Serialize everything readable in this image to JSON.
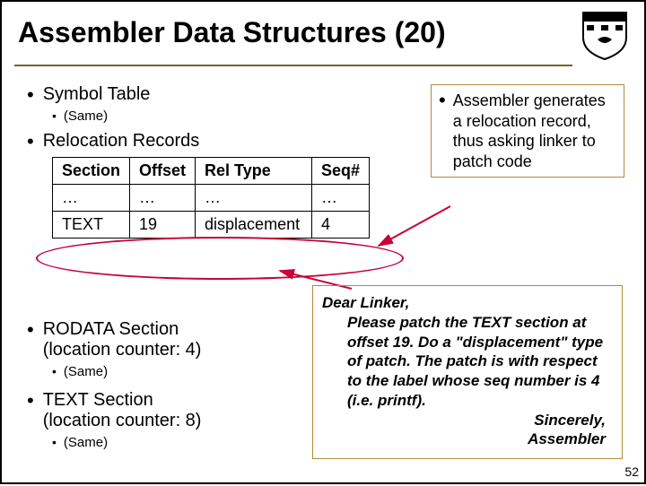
{
  "title": "Assembler Data Structures (20)",
  "page_number": "52",
  "bullets": {
    "symbol_table": "Symbol Table",
    "symbol_table_sub": "(Same)",
    "reloc_records": "Relocation Records",
    "rodata": "RODATA Section\n(location counter: 4)",
    "rodata_sub": "(Same)",
    "text_sec": "TEXT Section\n(location counter: 8)",
    "text_sec_sub": "(Same)"
  },
  "table": {
    "headers": {
      "c0": "Section",
      "c1": "Offset",
      "c2": "Rel Type",
      "c3": "Seq#"
    },
    "row0": {
      "c0": "…",
      "c1": "…",
      "c2": "…",
      "c3": "…"
    },
    "row1": {
      "c0": "TEXT",
      "c1": "19",
      "c2": "displacement",
      "c3": "4"
    }
  },
  "callout": "Assembler generates a relocation record, thus asking linker to patch code",
  "letter": {
    "greeting": "Dear Linker,",
    "body": "Please patch the TEXT section at offset 19. Do a \"displacement\" type of patch. The patch is with respect to the label whose seq number is 4 (i.e. printf).",
    "sign1": "Sincerely,",
    "sign2": "Assembler"
  }
}
